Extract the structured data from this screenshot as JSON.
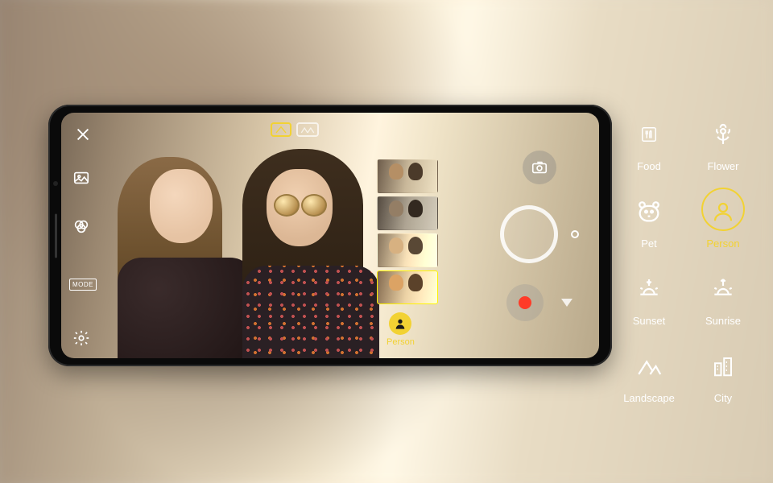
{
  "camera": {
    "mode_label": "MODE",
    "selected_scene_label": "Person",
    "filter_thumbs": [
      {
        "selected": false
      },
      {
        "selected": false
      },
      {
        "selected": false
      },
      {
        "selected": true
      }
    ],
    "top_lens": {
      "active": "standard"
    }
  },
  "icons": {
    "close": "close-icon",
    "gallery": "gallery-icon",
    "filters": "filters-icon",
    "mode": "mode-chip",
    "settings": "gear-icon",
    "switch_camera": "switch-camera-icon",
    "shutter": "shutter-button",
    "record": "record-button",
    "dropdown": "chevron-down-icon",
    "lens_standard": "lens-standard-icon",
    "lens_wide": "lens-wide-icon"
  },
  "scenes": [
    {
      "id": "food",
      "label": "Food",
      "active": false
    },
    {
      "id": "flower",
      "label": "Flower",
      "active": false
    },
    {
      "id": "pet",
      "label": "Pet",
      "active": false
    },
    {
      "id": "person",
      "label": "Person",
      "active": true
    },
    {
      "id": "sunset",
      "label": "Sunset",
      "active": false
    },
    {
      "id": "sunrise",
      "label": "Sunrise",
      "active": false
    },
    {
      "id": "landscape",
      "label": "Landscape",
      "active": false
    },
    {
      "id": "city",
      "label": "City",
      "active": false
    }
  ],
  "colors": {
    "accent": "#f2d233",
    "record": "#ff3b28"
  }
}
